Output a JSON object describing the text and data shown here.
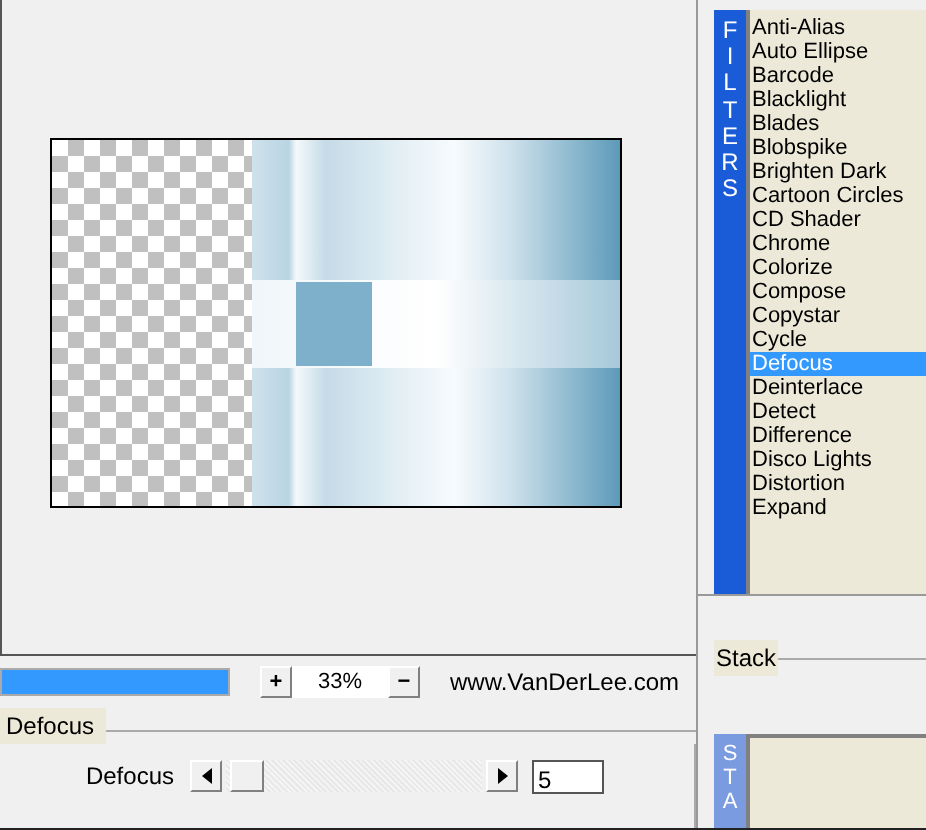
{
  "preview": {
    "zoom_in": "+",
    "zoom": "33%",
    "zoom_out": "−",
    "website": "www.VanDerLee.com",
    "progress": {
      "level": 1
    }
  },
  "filter_settings": {
    "title": "Defocus",
    "params": [
      {
        "label": "Defocus",
        "level": 0.02,
        "value": "5"
      }
    ]
  },
  "filters": {
    "side_label": "FILTERS",
    "items": [
      {
        "label": "Anti-Alias",
        "selected": false
      },
      {
        "label": "Auto Ellipse",
        "selected": false
      },
      {
        "label": "Barcode",
        "selected": false
      },
      {
        "label": "Blacklight",
        "selected": false
      },
      {
        "label": "Blades",
        "selected": false
      },
      {
        "label": "Blobspike",
        "selected": false
      },
      {
        "label": "Brighten Dark",
        "selected": false
      },
      {
        "label": "Cartoon Circles",
        "selected": false
      },
      {
        "label": "CD Shader",
        "selected": false
      },
      {
        "label": "Chrome",
        "selected": false
      },
      {
        "label": "Colorize",
        "selected": false
      },
      {
        "label": "Compose",
        "selected": false
      },
      {
        "label": "Copystar",
        "selected": false
      },
      {
        "label": "Cycle",
        "selected": false
      },
      {
        "label": "Defocus",
        "selected": true
      },
      {
        "label": "Deinterlace",
        "selected": false
      },
      {
        "label": "Detect",
        "selected": false
      },
      {
        "label": "Difference",
        "selected": false
      },
      {
        "label": "Disco Lights",
        "selected": false
      },
      {
        "label": "Distortion",
        "selected": false
      },
      {
        "label": "Expand",
        "selected": false
      }
    ]
  },
  "stack": {
    "title": "Stack",
    "side_label": "STA"
  }
}
